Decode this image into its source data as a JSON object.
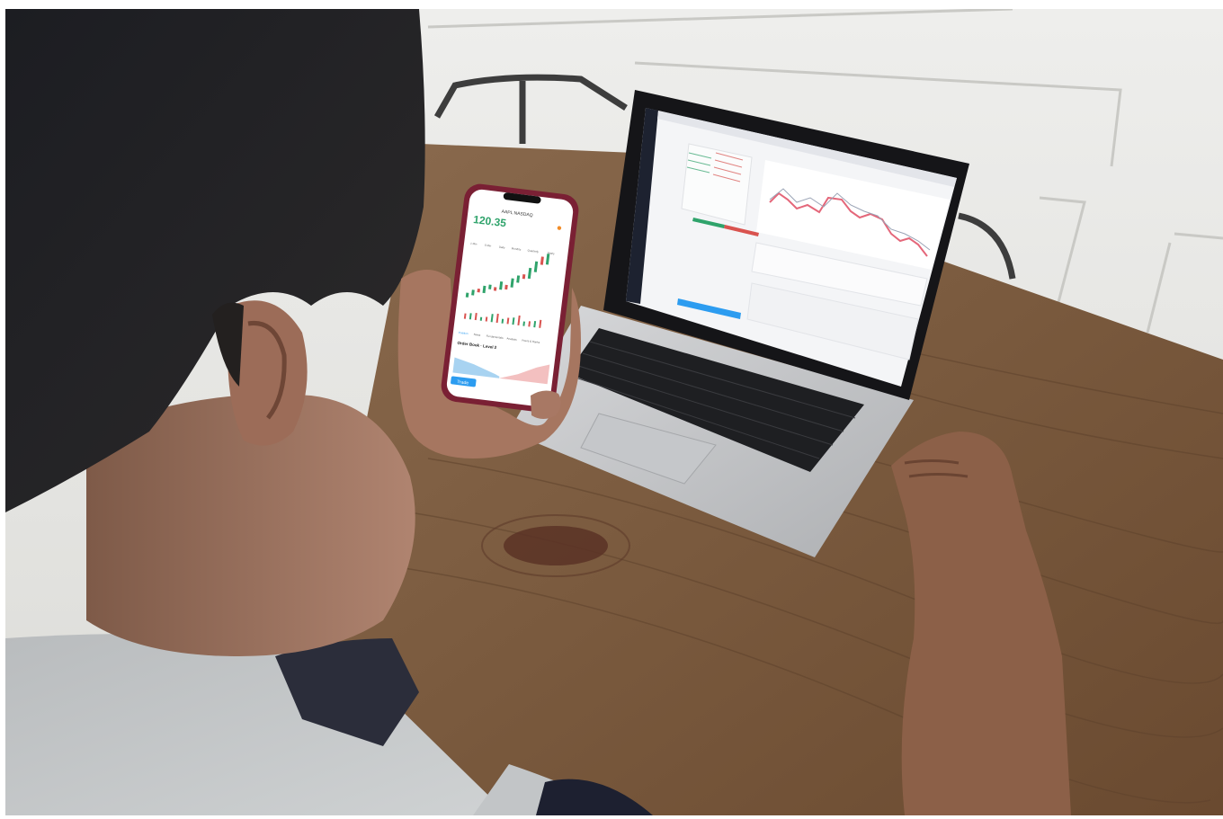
{
  "phone": {
    "ticker": "AAPL NASDAQ",
    "price": "120.35",
    "order_book_label": "Order Book · Level 2",
    "trade_button": "Trade",
    "tabs": [
      "1 Min",
      "5 Min",
      "Daily",
      "Monthly",
      "Quarterly",
      "Yearly"
    ],
    "subtabs": [
      "Position",
      "News",
      "Fundamentals",
      "Analysis",
      "Peers & Ranks"
    ],
    "colors": {
      "up": "#2fa36b",
      "down": "#d9534f",
      "accent": "#2c9cf0"
    }
  },
  "laptop": {
    "colors": {
      "up": "#2fa36b",
      "down": "#d9534f",
      "accent": "#2c9cf0"
    }
  }
}
